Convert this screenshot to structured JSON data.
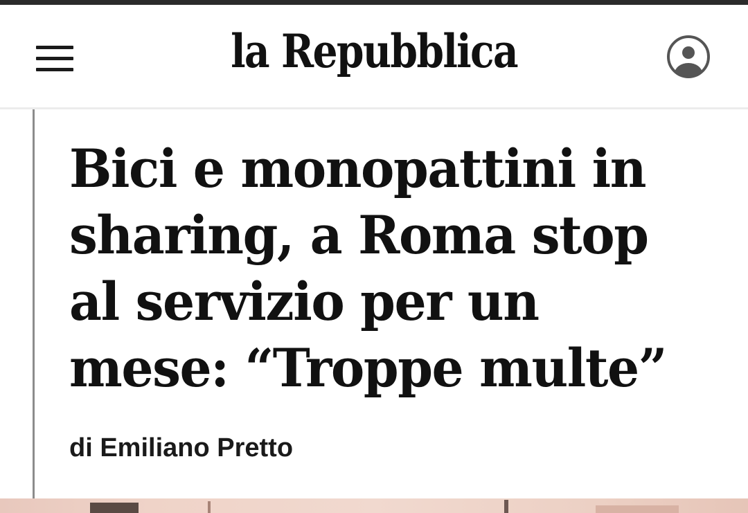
{
  "header": {
    "logo_text": "la Repubblica",
    "menu_icon": "hamburger-menu-icon",
    "account_icon": "user-account-icon"
  },
  "article": {
    "headline": "Bici e monopattini in sharing, a Roma stop al servizio per un mese: “Troppe multe”",
    "byline": "di Emiliano Pretto"
  },
  "colors": {
    "text": "#111111",
    "top_strip": "#2b2b2b",
    "left_rule": "#8c8c8c",
    "divider": "#ececec"
  }
}
